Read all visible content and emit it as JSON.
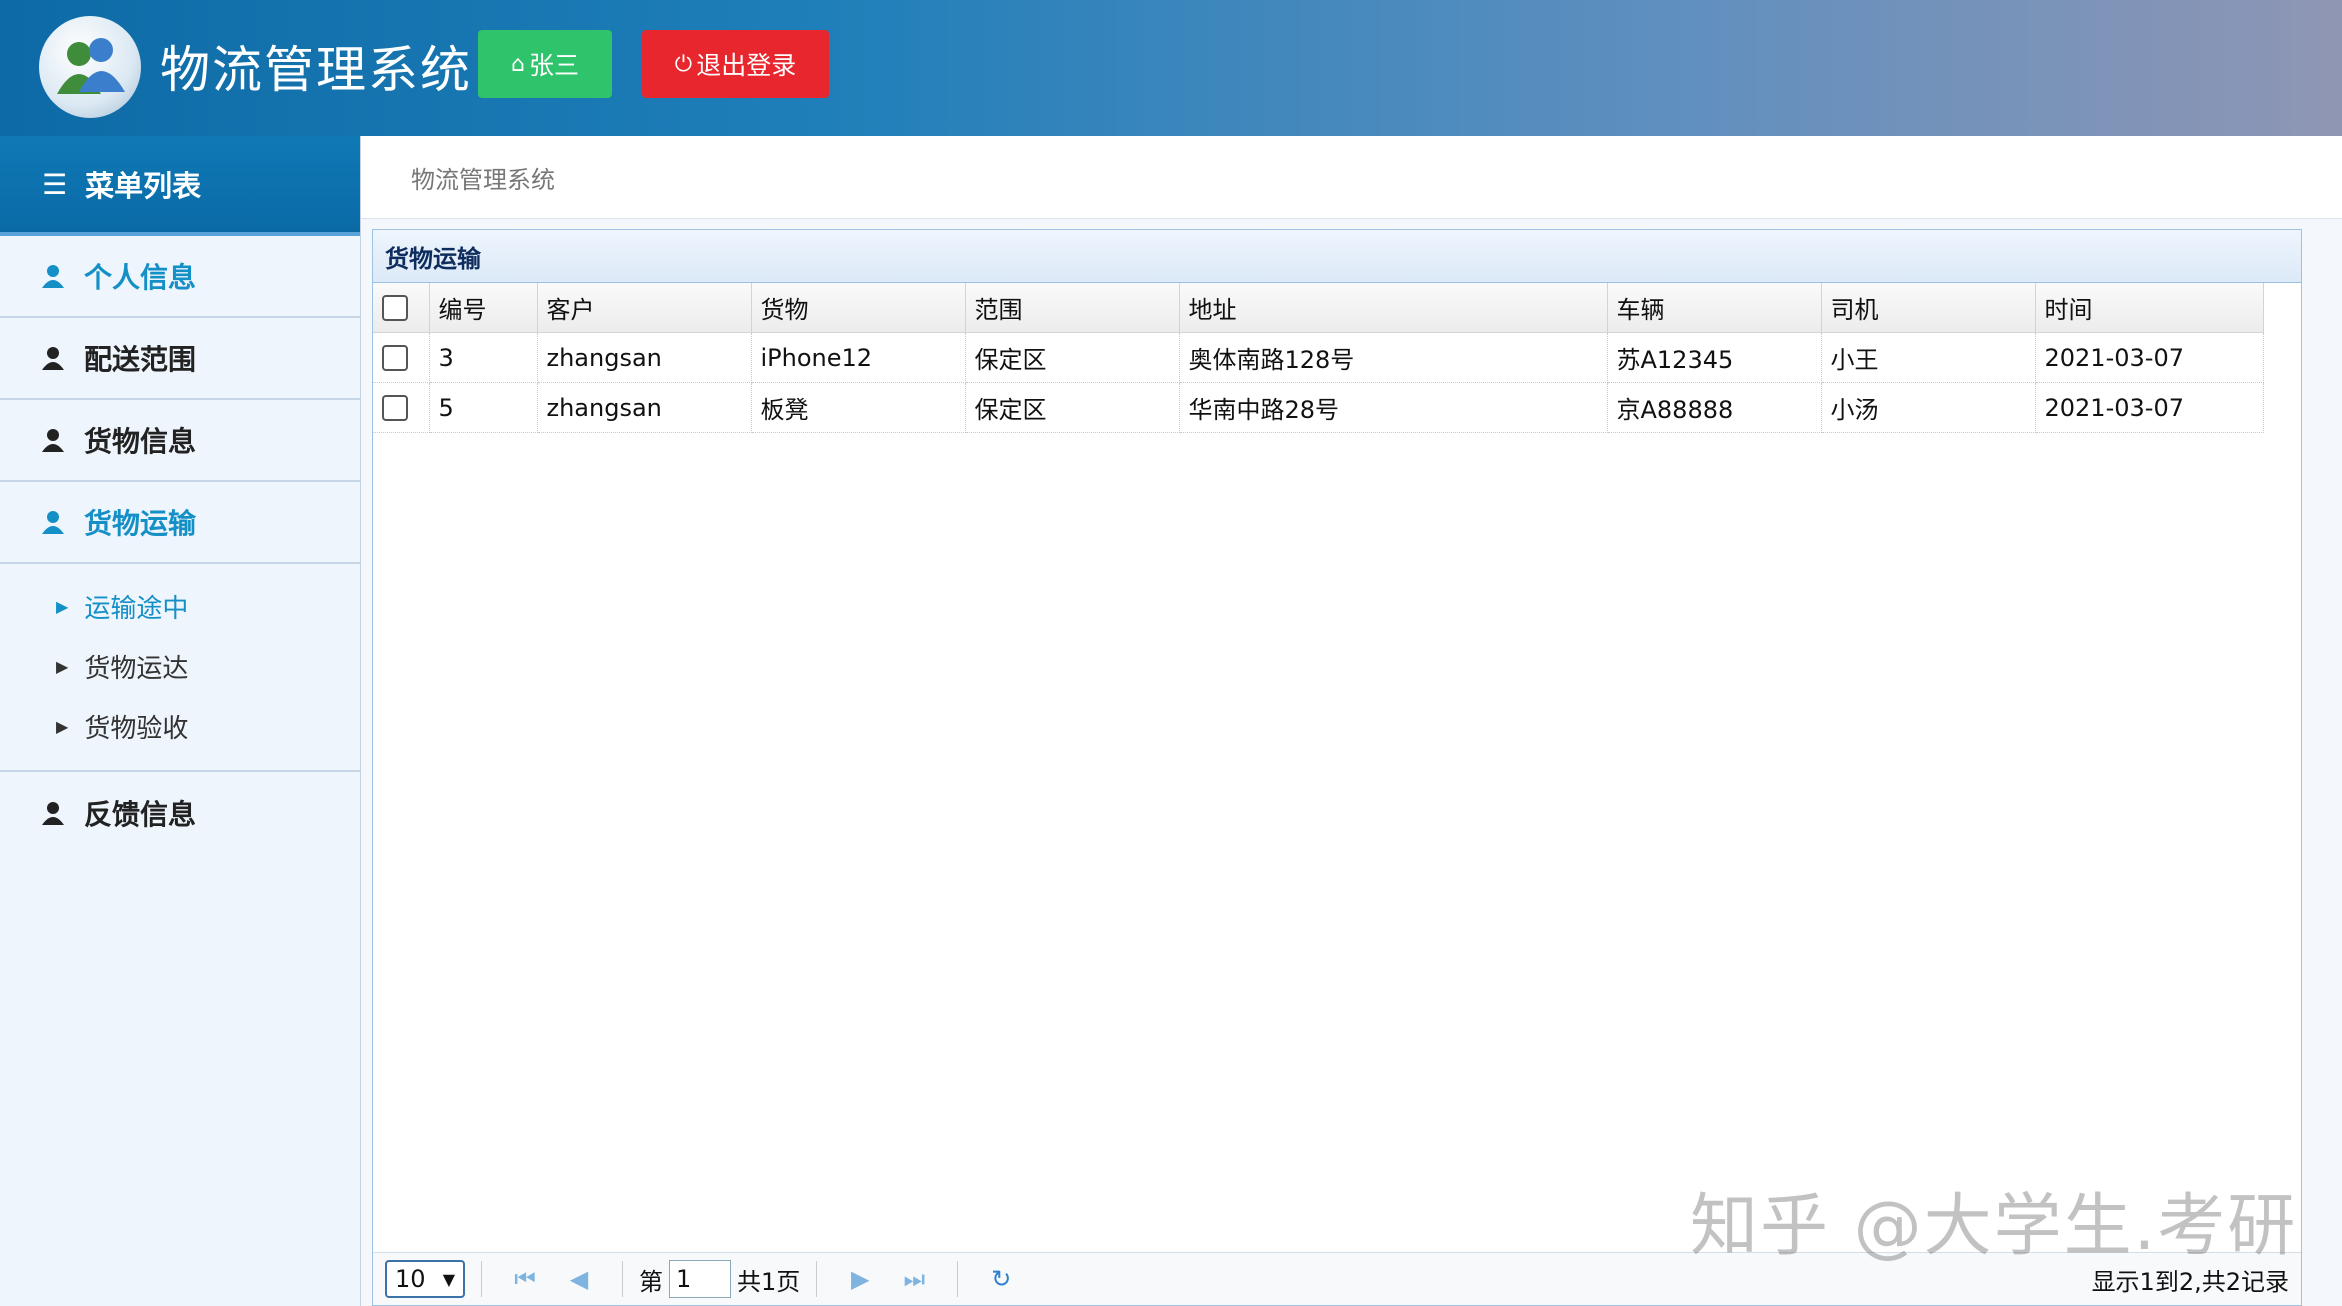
{
  "header": {
    "app_title": "物流管理系统",
    "user_button": "张三",
    "logout_button": "退出登录",
    "colors": {
      "header_left": "#0d6aa6",
      "user_button": "#2fc46b",
      "logout_button": "#e8262e"
    }
  },
  "sidebar": {
    "menu_title": "菜单列表",
    "items": [
      {
        "label": "个人信息",
        "icon": "user-icon",
        "active": true
      },
      {
        "label": "配送范围",
        "icon": "user-icon",
        "active": false
      },
      {
        "label": "货物信息",
        "icon": "user-icon",
        "active": false
      },
      {
        "label": "货物运输",
        "icon": "user-icon",
        "active": true
      }
    ],
    "subitems": [
      {
        "label": "运输途中",
        "active": true
      },
      {
        "label": "货物运达",
        "active": false
      },
      {
        "label": "货物验收",
        "active": false
      }
    ],
    "last_item": {
      "label": "反馈信息",
      "icon": "user-icon"
    }
  },
  "breadcrumb": "物流管理系统",
  "panel": {
    "title": "货物运输",
    "columns": [
      "编号",
      "客户",
      "货物",
      "范围",
      "地址",
      "车辆",
      "司机",
      "时间"
    ],
    "rows": [
      [
        "3",
        "zhangsan",
        "iPhone12",
        "保定区",
        "奥体南路128号",
        "苏A12345",
        "小王",
        "2021-03-07"
      ],
      [
        "5",
        "zhangsan",
        "板凳",
        "保定区",
        "华南中路28号",
        "京A88888",
        "小汤",
        "2021-03-07"
      ]
    ]
  },
  "pager": {
    "page_size": "10",
    "page_prefix": "第",
    "page_value": "1",
    "page_suffix": "共1页",
    "info": "显示1到2,共2记录"
  },
  "watermark": "知乎 @大学生.考研"
}
